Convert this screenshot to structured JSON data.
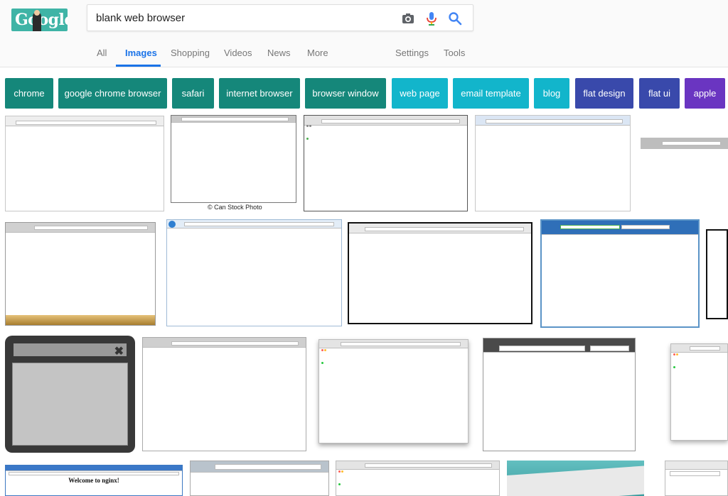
{
  "brand": {
    "logo_text": "Google"
  },
  "search": {
    "query": "blank web browser"
  },
  "icons": [
    "camera-icon",
    "microphone-icon",
    "search-icon",
    "close-icon"
  ],
  "nav": {
    "tabs": [
      {
        "label": "All"
      },
      {
        "label": "Images"
      },
      {
        "label": "Shopping"
      },
      {
        "label": "Videos"
      },
      {
        "label": "News"
      },
      {
        "label": "More"
      }
    ],
    "settings": "Settings",
    "tools": "Tools",
    "active_tab": "Images",
    "accent_color": "#1a73e8"
  },
  "chips": [
    {
      "label": "chrome",
      "color": "#15877a"
    },
    {
      "label": "google chrome browser",
      "color": "#15877a"
    },
    {
      "label": "safari",
      "color": "#15877a"
    },
    {
      "label": "internet browser",
      "color": "#15877a"
    },
    {
      "label": "browser window",
      "color": "#15877a"
    },
    {
      "label": "web page",
      "color": "#12b5cb"
    },
    {
      "label": "email template",
      "color": "#12b5cb"
    },
    {
      "label": "blog",
      "color": "#12b5cb"
    },
    {
      "label": "flat design",
      "color": "#3949ab"
    },
    {
      "label": "flat ui",
      "color": "#3949ab"
    },
    {
      "label": "apple",
      "color": "#6a35c1"
    }
  ],
  "results": {
    "captions": {
      "canstock": "© Can Stock Photo",
      "nginx": "Welcome to nginx!"
    }
  }
}
